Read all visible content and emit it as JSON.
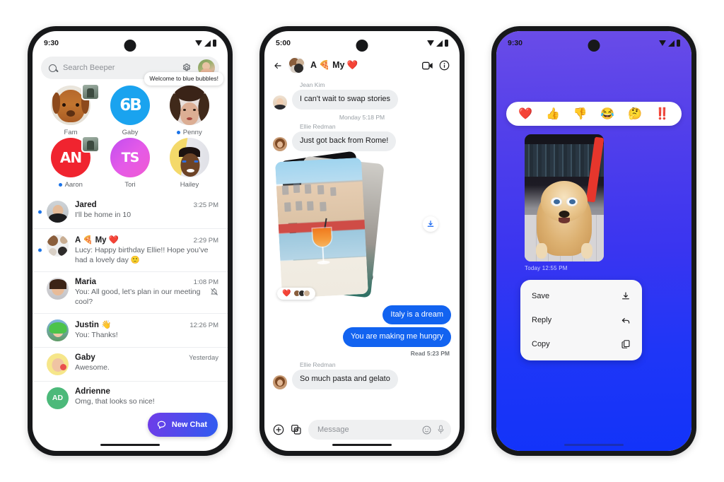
{
  "phone1": {
    "status": {
      "time": "9:30",
      "wifi_icon": "wifi-icon",
      "signal_icon": "signal-icon",
      "battery_icon": "battery-icon"
    },
    "search": {
      "placeholder": "Search Beeper",
      "search_icon": "search-icon",
      "settings_icon": "gear-icon",
      "avatar_icon": "avatar"
    },
    "stories": [
      {
        "name": "Fam",
        "unread": false,
        "avatar": "dog-photo-avatar",
        "has_badge": true
      },
      {
        "name": "Gaby",
        "unread": false,
        "avatar": "beeper-logo-avatar",
        "initials": "6B"
      },
      {
        "name": "Penny",
        "unread": true,
        "avatar": "penny-photo-avatar",
        "tooltip": "Welcome to blue bubbles!"
      },
      {
        "name": "Aaron",
        "unread": true,
        "avatar": "aaron-initials-avatar",
        "initials": "AN",
        "has_badge": true
      },
      {
        "name": "Tori",
        "unread": false,
        "avatar": "tori-initials-avatar",
        "initials": "TS"
      },
      {
        "name": "Hailey",
        "unread": false,
        "avatar": "hailey-photo-avatar"
      }
    ],
    "chats": [
      {
        "name": "Jared",
        "emoji": "",
        "time": "3:25 PM",
        "preview": "I'll be home in 10",
        "unread": true,
        "muted": false,
        "avatar": "jared-avatar"
      },
      {
        "name": "A 🍕 My ❤️",
        "emoji": "",
        "time": "2:29 PM",
        "preview": "Lucy: Happy birthday Ellie!! Hope you’ve had a lovely day  🙂",
        "unread": true,
        "muted": false,
        "avatar": "group-avatar"
      },
      {
        "name": "Maria",
        "emoji": "",
        "time": "1:08 PM",
        "preview": "You: All good, let’s plan in our meeting cool?",
        "unread": false,
        "muted": true,
        "avatar": "maria-avatar"
      },
      {
        "name": "Justin 👋",
        "emoji": "",
        "time": "12:26 PM",
        "preview": "You: Thanks!",
        "unread": false,
        "muted": false,
        "avatar": "justin-avatar"
      },
      {
        "name": "Gaby",
        "emoji": "",
        "time": "Yesterday",
        "preview": "Awesome.",
        "unread": false,
        "muted": false,
        "avatar": "gaby-avatar"
      },
      {
        "name": "Adrienne",
        "emoji": "",
        "time": "",
        "preview": "Omg, that looks so nice!",
        "unread": false,
        "muted": false,
        "avatar": "adrienne-avatar",
        "initials": "AD"
      }
    ],
    "fab": {
      "label": "New Chat",
      "icon": "chat-bubble-icon"
    }
  },
  "phone2": {
    "status": {
      "time": "5:00"
    },
    "header": {
      "back_icon": "back-arrow-icon",
      "title": "A 🍕 My ❤️",
      "video_icon": "video-call-icon",
      "info_icon": "info-icon",
      "avatar": "group-avatar"
    },
    "messages": [
      {
        "type": "incoming",
        "sender": "Jean Kim",
        "text": "I can't wait to swap stories",
        "avatar": "jean-kim-avatar"
      },
      {
        "type": "timestamp",
        "text": "Monday 5:18 PM"
      },
      {
        "type": "incoming",
        "sender": "Ellie Redman",
        "text": "Just got back from Rome!",
        "avatar": "ellie-redman-avatar"
      },
      {
        "type": "photo-stack",
        "reaction": "❤️",
        "download_icon": "download-icon"
      },
      {
        "type": "outgoing",
        "text": "Italy is a dream"
      },
      {
        "type": "outgoing",
        "text": "You are making me hungry"
      },
      {
        "type": "receipt",
        "text": "Read  5:23 PM"
      },
      {
        "type": "incoming",
        "sender": "Ellie Redman",
        "text": "So much pasta and gelato",
        "avatar": "ellie-redman-avatar"
      }
    ],
    "input": {
      "placeholder": "Message",
      "plus_icon": "plus-icon",
      "gallery_icon": "gallery-icon",
      "emoji_icon": "emoji-icon",
      "mic_icon": "microphone-icon"
    }
  },
  "phone3": {
    "status": {
      "time": "9:30"
    },
    "reactions": [
      "❤️",
      "👍",
      "👎",
      "😂",
      "🤔",
      "‼️"
    ],
    "photo": {
      "alt": "dog-with-sunglasses-photo",
      "timestamp": "Today  12:55 PM"
    },
    "menu": [
      {
        "label": "Save",
        "icon": "download-icon"
      },
      {
        "label": "Reply",
        "icon": "reply-arrow-icon"
      },
      {
        "label": "Copy",
        "icon": "copy-icon"
      }
    ]
  },
  "colors": {
    "accent_blue": "#1263f0",
    "unread_dot": "#1a73e8",
    "fab_gradient_start": "#6f3ce8",
    "fab_gradient_end": "#2f5bf0",
    "bubble_in": "#eceef0",
    "wallpaper_top": "#6a4ce8",
    "wallpaper_bottom": "#1233f9"
  }
}
